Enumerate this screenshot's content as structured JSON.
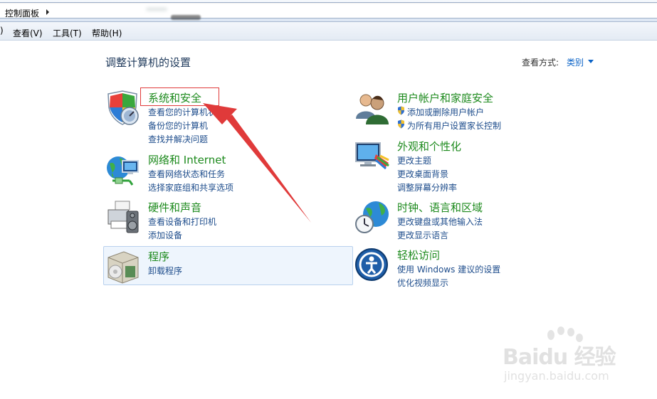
{
  "address_bar": {
    "breadcrumb": "控制面板"
  },
  "menu": {
    "items": [
      "查看(V)",
      "工具(T)",
      "帮助(H)"
    ]
  },
  "page": {
    "title": "调整计算机的设置",
    "view_by_label": "查看方式:",
    "view_by_value": "类别"
  },
  "categories": {
    "system_security": {
      "title": "系统和安全",
      "links": [
        "查看您的计算机状态",
        "备份您的计算机",
        "查找并解决问题"
      ]
    },
    "network": {
      "title": "网络和 Internet",
      "links": [
        "查看网络状态和任务",
        "选择家庭组和共享选项"
      ]
    },
    "hardware": {
      "title": "硬件和声音",
      "links": [
        "查看设备和打印机",
        "添加设备"
      ]
    },
    "programs": {
      "title": "程序",
      "links": [
        "卸载程序"
      ]
    },
    "user_accounts": {
      "title": "用户帐户和家庭安全",
      "links": [
        "添加或删除用户帐户",
        "为所有用户设置家长控制"
      ]
    },
    "appearance": {
      "title": "外观和个性化",
      "links": [
        "更改主题",
        "更改桌面背景",
        "调整屏幕分辨率"
      ]
    },
    "clock_region": {
      "title": "时钟、语言和区域",
      "links": [
        "更改键盘或其他输入法",
        "更改显示语言"
      ]
    },
    "ease_access": {
      "title": "轻松访问",
      "links": [
        "使用 Windows 建议的设置",
        "优化视频显示"
      ]
    }
  },
  "watermark": {
    "logo": "Baidu 经验",
    "url": "jingyan.baidu.com"
  },
  "colors": {
    "category_title": "#1d8a1d",
    "link": "#1e4d8c",
    "annotation": "#e03a3a"
  }
}
